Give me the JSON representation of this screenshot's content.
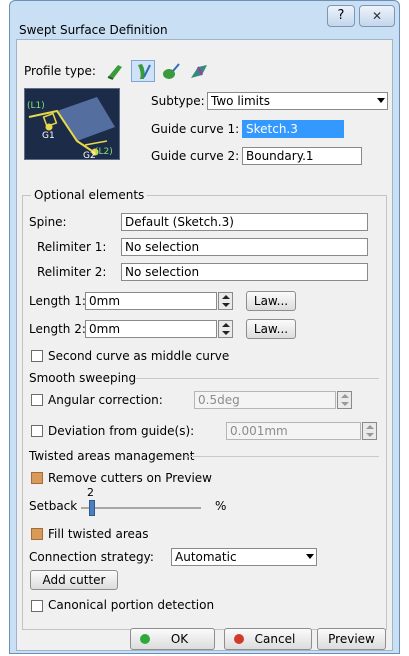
{
  "window": {
    "title": "Swept Surface Definition",
    "help_glyph": "?",
    "close_glyph": "✕"
  },
  "profile": {
    "label": "Profile type:",
    "tools": [
      {
        "icon": "line-profile-icon",
        "active": false
      },
      {
        "icon": "circle-profile-icon",
        "active": true
      },
      {
        "icon": "conic-profile-icon",
        "active": false
      },
      {
        "icon": "explicit-profile-icon",
        "active": false
      }
    ]
  },
  "preview_labels": {
    "l1": "(L1)",
    "g1": "G1",
    "l2": "(L2)",
    "g2": "G2"
  },
  "subtype": {
    "label": "Subtype:",
    "value": "Two limits"
  },
  "guide1": {
    "label": "Guide curve 1:",
    "value": "Sketch.3"
  },
  "guide2": {
    "label": "Guide curve 2:",
    "value": "Boundary.1"
  },
  "optional": {
    "title": "Optional elements",
    "spine": {
      "label": "Spine:",
      "value": "Default (Sketch.3)"
    },
    "relimiter1": {
      "label": "Relimiter 1:",
      "value": "No selection"
    },
    "relimiter2": {
      "label": "Relimiter 2:",
      "value": "No selection"
    },
    "length1": {
      "label": "Length 1:",
      "value": "0mm",
      "law": "Law..."
    },
    "length2": {
      "label": "Length 2:",
      "value": "0mm",
      "law": "Law..."
    },
    "middle_curve": "Second curve as middle curve",
    "smooth_title": "Smooth sweeping",
    "angular": {
      "label": "Angular correction:",
      "value": "0.5deg"
    },
    "deviation": {
      "label": "Deviation from guide(s):",
      "value": "0.001mm"
    },
    "twisted_title": "Twisted areas management",
    "remove_cutters": "Remove cutters on Preview",
    "setback": {
      "label": "Setback",
      "value": "2",
      "unit": "%",
      "level": 0.02
    },
    "fill_twisted": "Fill twisted areas",
    "connection": {
      "label": "Connection strategy:",
      "value": "Automatic"
    },
    "add_cutter": "Add cutter"
  },
  "canonical": "Canonical portion detection",
  "footer": {
    "ok": "OK",
    "cancel": "Cancel",
    "preview": "Preview"
  },
  "colors": {
    "ok_dot": "#2faa3a",
    "cancel_dot": "#d23a2a",
    "highlight": "#3399ff",
    "accent_check": "#d89a58"
  }
}
